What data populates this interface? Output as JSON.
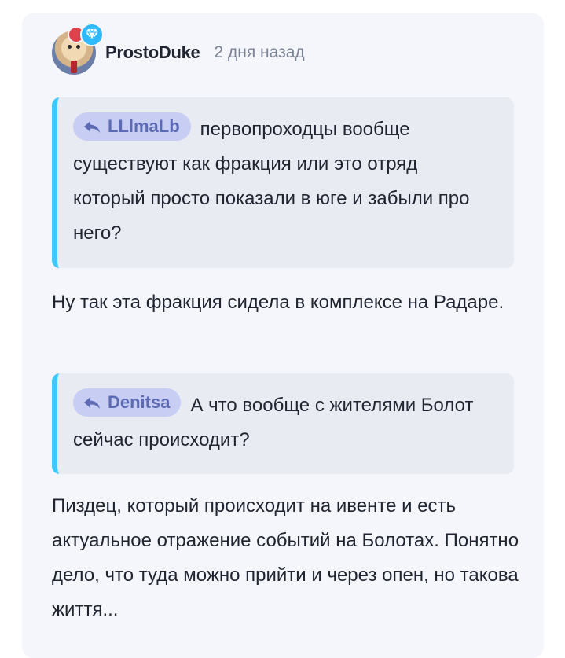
{
  "comment": {
    "author": "ProstoDuke",
    "time": "2 дня назад",
    "quotes": [
      {
        "user": "LLlmaLb",
        "text": "первопроходцы вообще существуют как фракция или это отряд который просто показали в юге и забыли про него?"
      },
      {
        "user": "Denitsa",
        "text": "А что вообще с жителями Болот сейчас происходит?"
      }
    ],
    "replies": [
      "Ну так эта фракция сидела в комплексе на Радаре.",
      "Пиздец, который происходит на ивенте и есть актуальное отражение событий на Болотах. Понятно дело, что туда можно прийти и через опен, но такова життя..."
    ]
  },
  "colors": {
    "accent": "#3ec8ff",
    "mention_bg": "#c7cdf3",
    "mention_text": "#5c6bb3",
    "card_bg": "#f5f6fb",
    "quote_bg": "#e8ebf2"
  },
  "icons": {
    "reply": "reply-arrow-icon",
    "gem": "diamond-icon"
  }
}
